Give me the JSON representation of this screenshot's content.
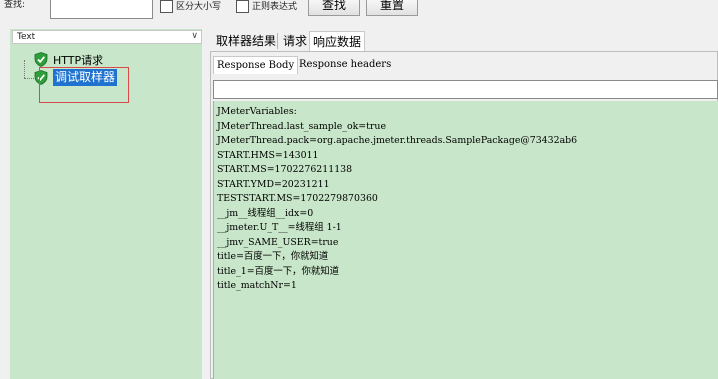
{
  "search_bar": {
    "label": "查找:",
    "input_value": "",
    "case_sensitive_label": "区分大小写",
    "regex_label": "正则表达式",
    "search_button": "查找",
    "reset_button": "重置"
  },
  "left_panel": {
    "combo_value": "Text",
    "combo_arrow": "∨",
    "tree": [
      {
        "label": "HTTP请求",
        "icon": "green-shield-check-icon",
        "selected": false
      },
      {
        "label": "调试取样器",
        "icon": "green-shield-check-icon",
        "selected": true
      }
    ]
  },
  "tabs": {
    "items": [
      "取样器结果",
      "请求",
      "响应数据"
    ],
    "active": "响应数据"
  },
  "subtabs": {
    "items": [
      "Response Body",
      "Response headers"
    ],
    "active": "Response Body"
  },
  "response": {
    "search_value": "",
    "lines": [
      "JMeterVariables:",
      "JMeterThread.last_sample_ok=true",
      "JMeterThread.pack=org.apache.jmeter.threads.SamplePackage@73432ab6",
      "START.HMS=143011",
      "START.MS=1702276211138",
      "START.YMD=20231211",
      "TESTSTART.MS=1702279870360",
      "__jm__线程组__idx=0",
      "__jmeter.U_T__=线程组 1-1",
      "__jmv_SAME_USER=true",
      "title=百度一下，你就知道",
      "title_1=百度一下，你就知道",
      "title_matchNr=1"
    ]
  },
  "colors": {
    "panel_green": "#c8e6c9",
    "selection_blue": "#1f72cf",
    "highlight_red": "#d94a4a",
    "shield_green": "#2e9e3a"
  }
}
